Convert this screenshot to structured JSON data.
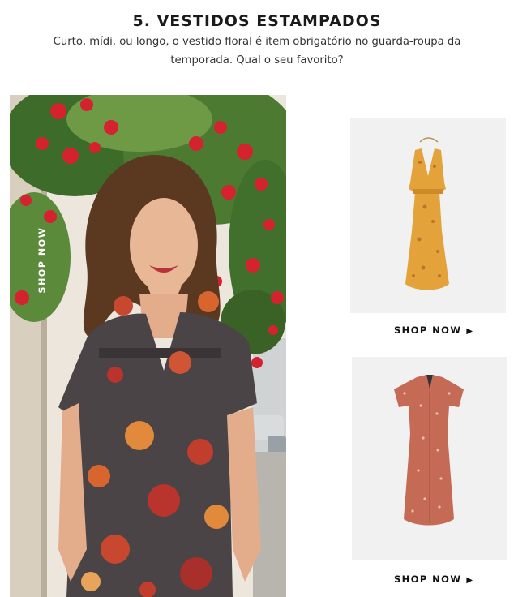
{
  "section": {
    "title": "5. VESTIDOS ESTAMPADOS",
    "description": "Curto, mídi, ou longo, o vestido floral é item obrigatório no guarda-roupa da temporada. Qual o seu favorito?"
  },
  "hero": {
    "vertical_cta": "SHOP NOW"
  },
  "products": [
    {
      "cta": "SHOP NOW",
      "arrow": "▶"
    },
    {
      "cta": "SHOP NOW",
      "arrow": "▶"
    }
  ],
  "colors": {
    "text": "#111111",
    "card_bg": "#f1f1f1",
    "dress_yellow": "#e3a23a",
    "dress_terracotta": "#c46a55",
    "hero_dress": "#4a4446"
  }
}
